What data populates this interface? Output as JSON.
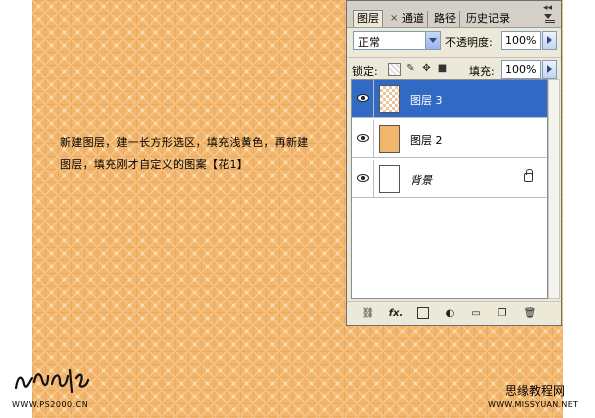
{
  "instructions": {
    "line1": "新建图层，建一长方形选区，填充浅黄色，再新建",
    "line2": "图层，填充刚才自定义的图案【花1】"
  },
  "palette": {
    "tabs": [
      "图层",
      "通道",
      "路径",
      "历史记录"
    ],
    "close_glyph": "×",
    "collapse_glyph": "◂◂",
    "blend_mode": "正常",
    "opacity_label": "不透明度:",
    "opacity_value": "100%",
    "lock_label": "锁定:",
    "fill_label": "填充:",
    "fill_value": "100%",
    "layers": [
      {
        "name": "图层 3",
        "thumbnail": "checker-pattern",
        "selected": true
      },
      {
        "name": "图层 2",
        "thumbnail": "tan-fill",
        "selected": false
      },
      {
        "name": "背景",
        "thumbnail": "white",
        "selected": false,
        "locked": true
      }
    ],
    "bottom_icons": [
      "link-icon",
      "fx-icon",
      "mask-icon",
      "adjustment-icon",
      "group-icon",
      "new-layer-icon",
      "trash-icon"
    ],
    "fx_label": "fx."
  },
  "watermarks": {
    "left": "WWW.PS2000.CN",
    "right_cn": "思缘教程网",
    "right_en": "WWW.MISSYUAN.NET"
  },
  "colors": {
    "canvas": "#f2b56c",
    "selection": "#316ac5",
    "panel": "#ece9d8"
  }
}
